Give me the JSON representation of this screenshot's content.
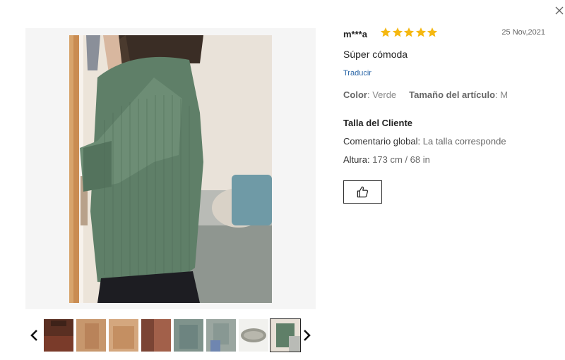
{
  "review": {
    "username": "m***a",
    "rating": 5,
    "date": "25 Nov,2021",
    "title": "Súper cómoda",
    "translate_label": "Traducir",
    "attributes": [
      {
        "label": "Color",
        "value": "Verde"
      },
      {
        "label": "Tamaño del artículo",
        "value": "M"
      }
    ],
    "fit": {
      "heading": "Talla del Cliente",
      "overall_label": "Comentario global",
      "overall_value": "La talla corresponde",
      "height_label": "Altura",
      "height_value": "173 cm / 68 in"
    }
  },
  "icons": {
    "close": "close-icon",
    "star": "star-icon",
    "prev": "chevron-left-icon",
    "next": "chevron-right-icon",
    "like": "thumbs-up-icon"
  },
  "colors": {
    "star": "#f5b811",
    "link": "#2d68a8",
    "sweater": "#5f7f68",
    "panel_bg": "#f5f5f5"
  },
  "gallery": {
    "thumb_count": 8,
    "active_index": 7
  }
}
